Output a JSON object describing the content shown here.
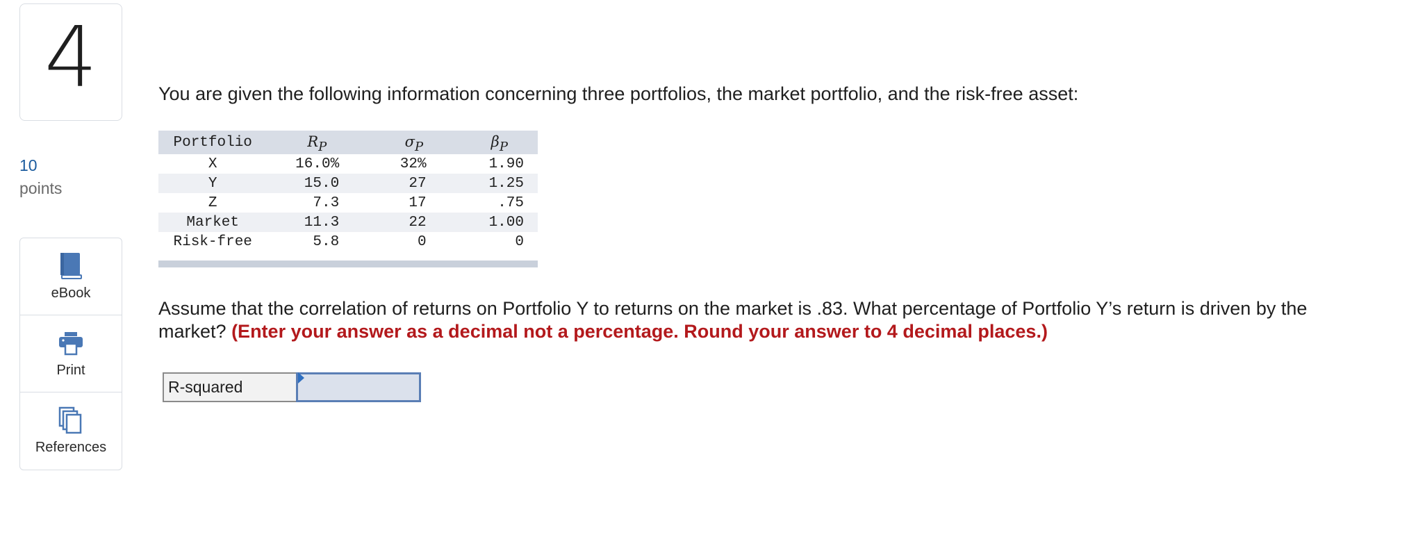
{
  "question": {
    "number": "4",
    "points_value": "10",
    "points_label": "points"
  },
  "tools": [
    {
      "label": "eBook",
      "icon": "book-icon"
    },
    {
      "label": "Print",
      "icon": "printer-icon"
    },
    {
      "label": "References",
      "icon": "documents-icon"
    }
  ],
  "intro": "You are given the following information concerning three portfolios, the market portfolio, and the risk-free asset:",
  "table": {
    "headers": {
      "portfolio": "Portfolio",
      "r_symbol": "R",
      "r_sub": "P",
      "sigma_symbol": "σ",
      "sigma_sub": "P",
      "beta_symbol": "β",
      "beta_sub": "P"
    },
    "rows": [
      {
        "portfolio": "X",
        "r": "16.0%",
        "sigma": "32%",
        "beta": "1.90"
      },
      {
        "portfolio": "Y",
        "r": "15.0",
        "sigma": "27",
        "beta": "1.25"
      },
      {
        "portfolio": "Z",
        "r": "7.3",
        "sigma": "17",
        "beta": ".75"
      },
      {
        "portfolio": "Market",
        "r": "11.3",
        "sigma": "22",
        "beta": "1.00"
      },
      {
        "portfolio": "Risk-free",
        "r": "5.8",
        "sigma": "0",
        "beta": "0"
      }
    ]
  },
  "question_text": "Assume that the correlation of returns on Portfolio Y to returns on the market is .83. What percentage of Portfolio Y’s return is driven by the market?",
  "instruction": "(Enter your answer as a decimal not a percentage. Round your answer to 4 decimal places.)",
  "answer": {
    "label": "R-squared",
    "value": ""
  },
  "colors": {
    "accent_blue": "#2f6fc0",
    "instruction_red": "#b3191c",
    "table_header": "#d8dde6"
  }
}
